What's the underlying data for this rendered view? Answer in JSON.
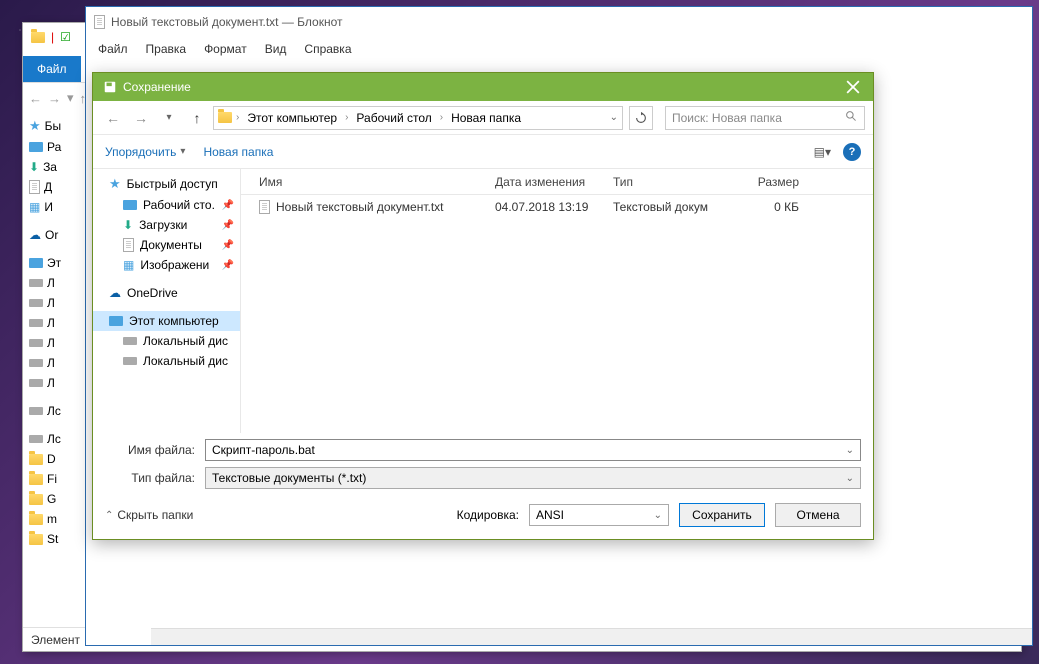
{
  "explorer_bg": {
    "tab": "Файл",
    "sidebar": [
      "Бы",
      "Ра",
      "За",
      "Д",
      "И",
      "Or",
      "Эт",
      "Л",
      "Л",
      "Л",
      "Л",
      "Л",
      "Л",
      "Лс",
      "Лс",
      "D",
      "Fi",
      "G",
      "m",
      "St"
    ],
    "status": "Элемент"
  },
  "notepad": {
    "title": "Новый текстовый документ.txt — Блокнот",
    "menu": [
      "Файл",
      "Правка",
      "Формат",
      "Вид",
      "Справка"
    ]
  },
  "dialog": {
    "title": "Сохранение",
    "breadcrumb": [
      "Этот компьютер",
      "Рабочий стол",
      "Новая папка"
    ],
    "search_placeholder": "Поиск: Новая папка",
    "toolbar": {
      "organize": "Упорядочить",
      "newfolder": "Новая папка"
    },
    "sidebar": {
      "quick": "Быстрый доступ",
      "desktop": "Рабочий сто.",
      "downloads": "Загрузки",
      "documents": "Документы",
      "pictures": "Изображени",
      "onedrive": "OneDrive",
      "thispc": "Этот компьютер",
      "local1": "Локальный дис",
      "local2": "Локальный дис"
    },
    "columns": {
      "name": "Имя",
      "date": "Дата изменения",
      "type": "Тип",
      "size": "Размер"
    },
    "files": [
      {
        "name": "Новый текстовый документ.txt",
        "date": "04.07.2018 13:19",
        "type": "Текстовый докум",
        "size": "0 КБ"
      }
    ],
    "filename_label": "Имя файла:",
    "filename_value": "Скрипт-пароль.bat",
    "filetype_label": "Тип файла:",
    "filetype_value": "Текстовые документы (*.txt)",
    "hide_folders": "Скрыть папки",
    "encoding_label": "Кодировка:",
    "encoding_value": "ANSI",
    "save_btn": "Сохранить",
    "cancel_btn": "Отмена"
  }
}
